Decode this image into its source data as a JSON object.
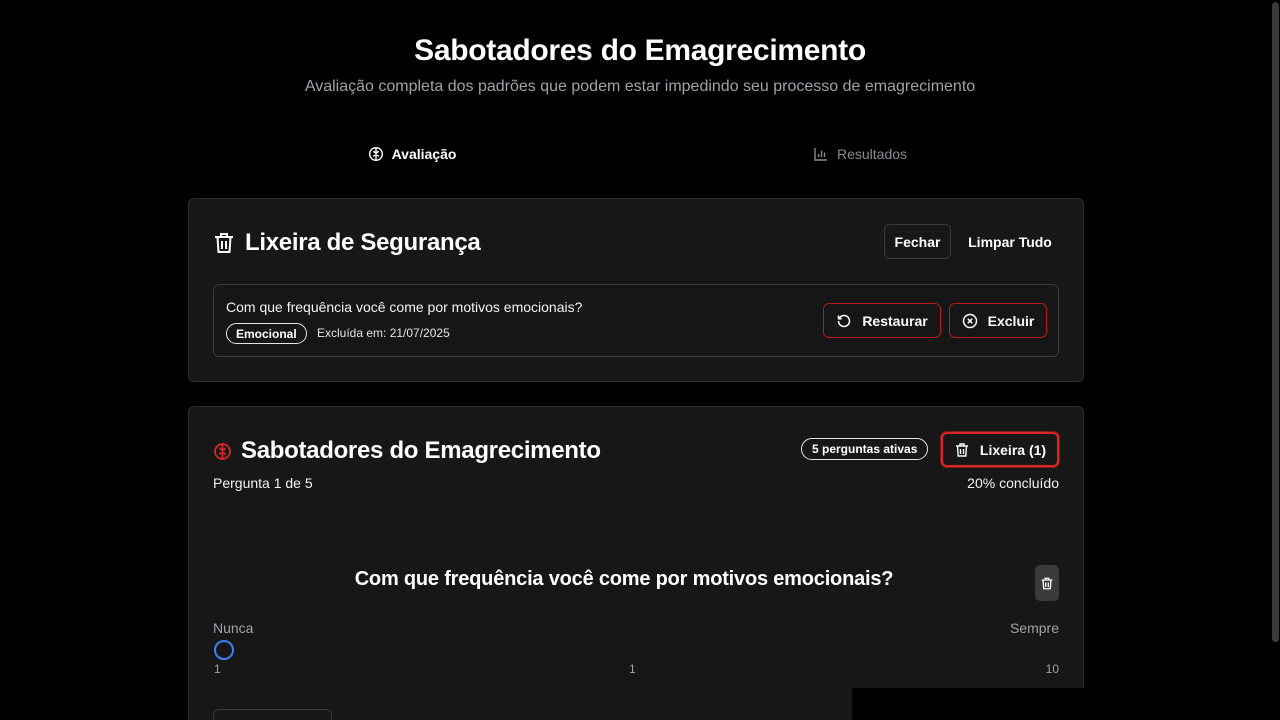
{
  "header": {
    "title": "Sabotadores do Emagrecimento",
    "subtitle": "Avaliação completa dos padrões que podem estar impedindo seu processo de emagrecimento"
  },
  "tabs": [
    {
      "label": "Avaliação",
      "icon": "brain-icon",
      "active": true
    },
    {
      "label": "Resultados",
      "icon": "bar-chart-icon",
      "active": false
    }
  ],
  "trash": {
    "title": "Lixeira de Segurança",
    "close_label": "Fechar",
    "clear_label": "Limpar Tudo",
    "items": [
      {
        "question": "Com que frequência você come por motivos emocionais?",
        "category": "Emocional",
        "deleted_at": "Excluída em: 21/07/2025",
        "restore_label": "Restaurar",
        "delete_label": "Excluir"
      }
    ]
  },
  "assessment": {
    "title": "Sabotadores do Emagrecimento",
    "active_badge": "5 perguntas ativas",
    "trash_button": "Lixeira (1)",
    "progress_text": "Pergunta 1 de 5",
    "progress_percent_text": "20% concluído",
    "question": "Com que frequência você come por motivos emocionais?",
    "scale_min_label": "Nunca",
    "scale_max_label": "Sempre",
    "scale_ticks": [
      "1",
      "1",
      "10"
    ]
  },
  "colors": {
    "background": "#000000",
    "card": "#171717",
    "accent_red": "#dc2626",
    "radio_blue": "#3b82f6"
  }
}
